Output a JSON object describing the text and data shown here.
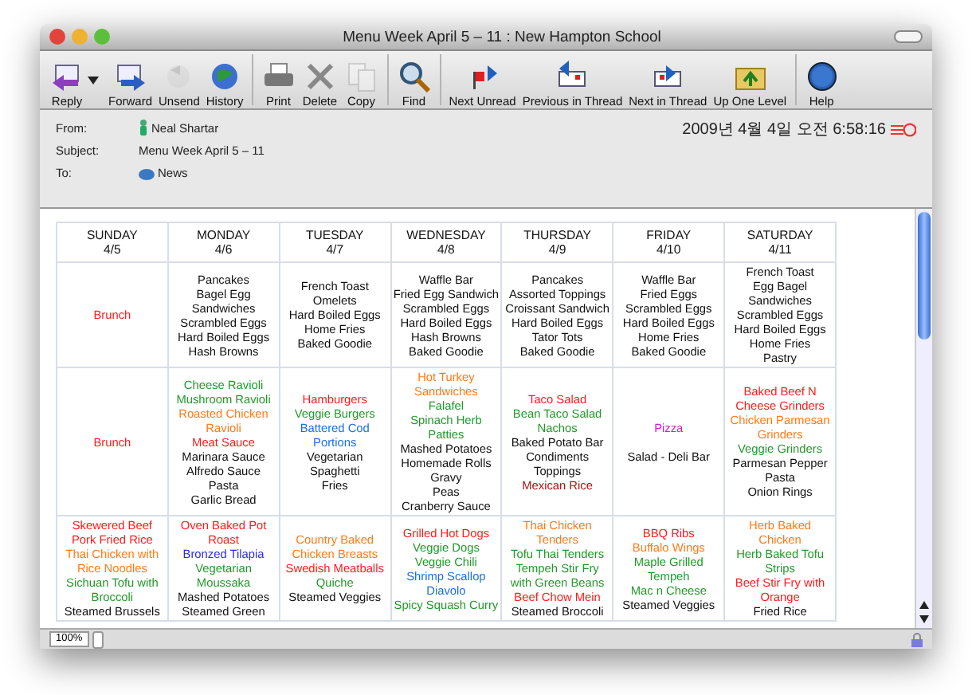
{
  "window": {
    "title": "Menu Week April 5 – 11 : New Hampton School"
  },
  "toolbar": [
    {
      "label": "Reply",
      "disabled": false,
      "menu": true
    },
    {
      "label": "Forward",
      "disabled": false
    },
    {
      "label": "Unsend",
      "disabled": true
    },
    {
      "label": "History",
      "disabled": false
    },
    {
      "label": "Print",
      "disabled": false
    },
    {
      "label": "Delete",
      "disabled": false
    },
    {
      "label": "Copy",
      "disabled": true
    },
    {
      "label": "Find",
      "disabled": false
    },
    {
      "label": "Next Unread",
      "disabled": false
    },
    {
      "label": "Previous in Thread",
      "disabled": false
    },
    {
      "label": "Next in Thread",
      "disabled": false
    },
    {
      "label": "Up One Level",
      "disabled": false
    },
    {
      "label": "Help",
      "disabled": false
    }
  ],
  "header": {
    "fields": [
      {
        "label": "From:",
        "value": "Neal Shartar"
      },
      {
        "label": "Subject:",
        "value": "Menu Week April 5 – 11"
      },
      {
        "label": "To:",
        "value": "News"
      }
    ],
    "date": "2009년 4월 4일 오전 6:58:16"
  },
  "menu": {
    "days": [
      {
        "name": "SUNDAY",
        "date": "4/5"
      },
      {
        "name": "MONDAY",
        "date": "4/6"
      },
      {
        "name": "TUESDAY",
        "date": "4/7"
      },
      {
        "name": "WEDNESDAY",
        "date": "4/8"
      },
      {
        "name": "THURSDAY",
        "date": "4/9"
      },
      {
        "name": "FRIDAY",
        "date": "4/10"
      },
      {
        "name": "SATURDAY",
        "date": "4/11"
      }
    ],
    "rows": [
      [
        [
          {
            "text": "Brunch",
            "color": "#ff1a1a"
          }
        ],
        [
          {
            "text": "Pancakes",
            "color": "#111111"
          },
          {
            "text": "Bagel Egg",
            "color": "#111111"
          },
          {
            "text": "Sandwiches",
            "color": "#111111"
          },
          {
            "text": "Scrambled Eggs",
            "color": "#111111"
          },
          {
            "text": "Hard Boiled Eggs",
            "color": "#111111"
          },
          {
            "text": "Hash Browns",
            "color": "#111111"
          }
        ],
        [
          {
            "text": "French Toast",
            "color": "#111111"
          },
          {
            "text": "Omelets",
            "color": "#111111"
          },
          {
            "text": "Hard Boiled Eggs",
            "color": "#111111"
          },
          {
            "text": "Home Fries",
            "color": "#111111"
          },
          {
            "text": "Baked Goodie",
            "color": "#111111"
          }
        ],
        [
          {
            "text": "Waffle Bar",
            "color": "#111111"
          },
          {
            "text": "Fried Egg Sandwich",
            "color": "#111111"
          },
          {
            "text": "Scrambled Eggs",
            "color": "#111111"
          },
          {
            "text": "Hard Boiled Eggs",
            "color": "#111111"
          },
          {
            "text": "Hash Browns",
            "color": "#111111"
          },
          {
            "text": "Baked Goodie",
            "color": "#111111"
          }
        ],
        [
          {
            "text": "Pancakes",
            "color": "#111111"
          },
          {
            "text": "Assorted Toppings",
            "color": "#111111"
          },
          {
            "text": "Croissant Sandwich",
            "color": "#111111"
          },
          {
            "text": "Hard Boiled Eggs",
            "color": "#111111"
          },
          {
            "text": "Tator Tots",
            "color": "#111111"
          },
          {
            "text": "Baked Goodie",
            "color": "#111111"
          }
        ],
        [
          {
            "text": "Waffle Bar",
            "color": "#111111"
          },
          {
            "text": "Fried Eggs",
            "color": "#111111"
          },
          {
            "text": "Scrambled Eggs",
            "color": "#111111"
          },
          {
            "text": "Hard Boiled Eggs",
            "color": "#111111"
          },
          {
            "text": "Home Fries",
            "color": "#111111"
          },
          {
            "text": "Baked Goodie",
            "color": "#111111"
          }
        ],
        [
          {
            "text": "French Toast",
            "color": "#111111"
          },
          {
            "text": "Egg Bagel",
            "color": "#111111"
          },
          {
            "text": "Sandwiches",
            "color": "#111111"
          },
          {
            "text": "Scrambled Eggs",
            "color": "#111111"
          },
          {
            "text": "Hard Boiled Eggs",
            "color": "#111111"
          },
          {
            "text": "Home Fries",
            "color": "#111111"
          },
          {
            "text": "Pastry",
            "color": "#111111"
          }
        ]
      ],
      [
        [
          {
            "text": "Brunch",
            "color": "#ff1a1a"
          }
        ],
        [
          {
            "text": "Cheese Ravioli",
            "color": "#22992a"
          },
          {
            "text": "Mushroom Ravioli",
            "color": "#22992a"
          },
          {
            "text": "Roasted Chicken Ravioli",
            "color": "#ff7a1a"
          },
          {
            "text": "Meat Sauce",
            "color": "#ff1a1a"
          },
          {
            "text": "Marinara Sauce",
            "color": "#111111"
          },
          {
            "text": "Alfredo Sauce",
            "color": "#111111"
          },
          {
            "text": "Pasta",
            "color": "#111111"
          },
          {
            "text": "Garlic Bread",
            "color": "#111111"
          }
        ],
        [
          {
            "text": "Hamburgers",
            "color": "#ff1a1a"
          },
          {
            "text": "Veggie Burgers",
            "color": "#22992a"
          },
          {
            "text": "Battered Cod Portions",
            "color": "#1a6fe0"
          },
          {
            "text": "Vegetarian Spaghetti",
            "color": "#111111"
          },
          {
            "text": "Fries",
            "color": "#111111"
          }
        ],
        [
          {
            "text": "Hot Turkey Sandwiches",
            "color": "#ff7a1a"
          },
          {
            "text": "Falafel",
            "color": "#22992a"
          },
          {
            "text": "Spinach Herb Patties",
            "color": "#22992a"
          },
          {
            "text": "Mashed Potatoes",
            "color": "#111111"
          },
          {
            "text": "Homemade Rolls",
            "color": "#111111"
          },
          {
            "text": "Gravy",
            "color": "#111111"
          },
          {
            "text": "Peas",
            "color": "#111111"
          },
          {
            "text": "Cranberry Sauce",
            "color": "#111111"
          }
        ],
        [
          {
            "text": "Taco Salad",
            "color": "#ff1a1a"
          },
          {
            "text": "Bean Taco Salad",
            "color": "#22992a"
          },
          {
            "text": "Nachos",
            "color": "#22992a"
          },
          {
            "text": "Baked Potato Bar",
            "color": "#111111"
          },
          {
            "text": "Condiments",
            "color": "#111111"
          },
          {
            "text": "Toppings",
            "color": "#111111"
          },
          {
            "text": "Mexican Rice",
            "color": "#b01010"
          }
        ],
        [
          {
            "text": "Pizza",
            "color": "#cc22bb"
          },
          {
            "text": "Salad - Deli Bar",
            "color": "#111111"
          }
        ],
        [
          {
            "text": "Baked Beef  N Cheese Grinders",
            "color": "#ff1a1a"
          },
          {
            "text": "Chicken Parmesan Grinders",
            "color": "#ff7a1a"
          },
          {
            "text": "Veggie Grinders",
            "color": "#22992a"
          },
          {
            "text": "Parmesan Pepper Pasta",
            "color": "#111111"
          },
          {
            "text": "Onion Rings",
            "color": "#111111"
          }
        ]
      ],
      [
        [
          {
            "text": "Skewered Beef",
            "color": "#ff1a1a"
          },
          {
            "text": "Pork Fried Rice",
            "color": "#ff1a1a"
          },
          {
            "text": "Thai Chicken with Rice Noodles",
            "color": "#ff7a1a"
          },
          {
            "text": "Sichuan Tofu with Broccoli",
            "color": "#22992a"
          },
          {
            "text": "Steamed Brussels",
            "color": "#111111"
          }
        ],
        [
          {
            "text": "Oven Baked Pot Roast",
            "color": "#ff1a1a"
          },
          {
            "text": "Bronzed Tilapia",
            "color": "#2a2af0"
          },
          {
            "text": "Vegetarian Moussaka",
            "color": "#22992a"
          },
          {
            "text": "Mashed Potatoes",
            "color": "#111111"
          },
          {
            "text": "Steamed Green",
            "color": "#111111"
          }
        ],
        [
          {
            "text": "Country Baked Chicken Breasts",
            "color": "#ff7a1a"
          },
          {
            "text": "Swedish Meatballs",
            "color": "#ff1a1a"
          },
          {
            "text": "Quiche",
            "color": "#22992a"
          },
          {
            "text": "Steamed Veggies",
            "color": "#111111"
          }
        ],
        [
          {
            "text": "Grilled Hot Dogs",
            "color": "#ff1a1a"
          },
          {
            "text": "Veggie Dogs",
            "color": "#22992a"
          },
          {
            "text": "Veggie Chili",
            "color": "#22992a"
          },
          {
            "text": "Shrimp Scallop Diavolo",
            "color": "#1a6fe0"
          },
          {
            "text": "Spicy Squash Curry",
            "color": "#22992a"
          }
        ],
        [
          {
            "text": "Thai Chicken Tenders",
            "color": "#ff7a1a"
          },
          {
            "text": "Tofu Thai Tenders",
            "color": "#22992a"
          },
          {
            "text": "Tempeh Stir Fry with Green Beans",
            "color": "#22992a"
          },
          {
            "text": "Beef Chow Mein",
            "color": "#ff1a1a"
          },
          {
            "text": "Steamed Broccoli",
            "color": "#111111"
          }
        ],
        [
          {
            "text": "BBQ Ribs",
            "color": "#ff1a1a"
          },
          {
            "text": "Buffalo Wings",
            "color": "#ff7a1a"
          },
          {
            "text": "Maple Grilled Tempeh",
            "color": "#22992a"
          },
          {
            "text": "Mac n Cheese",
            "color": "#22992a"
          },
          {
            "text": "Steamed Veggies",
            "color": "#111111"
          }
        ],
        [
          {
            "text": "Herb Baked  Chicken",
            "color": "#ff7a1a"
          },
          {
            "text": "Herb Baked  Tofu Strips",
            "color": "#22992a"
          },
          {
            "text": "Beef Stir Fry with Orange",
            "color": "#ff1a1a"
          },
          {
            "text": "Fried Rice",
            "color": "#111111"
          }
        ]
      ]
    ]
  },
  "status_bar": {
    "zoom": "100%"
  }
}
